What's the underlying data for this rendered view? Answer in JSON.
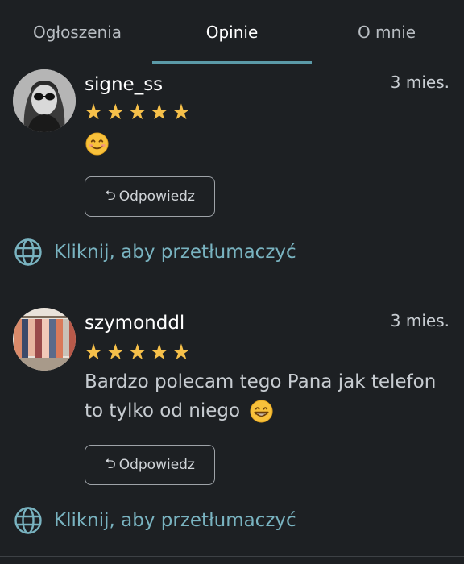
{
  "tabs": [
    {
      "label": "Ogłoszenia"
    },
    {
      "label": "Opinie"
    },
    {
      "label": "O mnie"
    }
  ],
  "reviews": [
    {
      "username": "signe_ss",
      "time": "3 mies.",
      "rating": 5,
      "comment_emoji": "smiling-face-emoji",
      "comment_text": "",
      "reply_label": "Odpowiedz",
      "translate_label": "Kliknij, aby przetłumaczyć"
    },
    {
      "username": "szymonddl",
      "time": "3 mies.",
      "rating": 5,
      "comment_text_line1": "Bardzo polecam tego Pana jak telefon",
      "comment_text_line2": "to tylko od niego",
      "comment_emoji": "grinning-face-emoji",
      "reply_label": "Odpowiedz",
      "translate_label": "Kliknij, aby przetłumaczyć"
    }
  ],
  "colors": {
    "background": "#1d2023",
    "accent": "#5b9aa8",
    "star": "#f6c04a",
    "link": "#79b3c0"
  }
}
